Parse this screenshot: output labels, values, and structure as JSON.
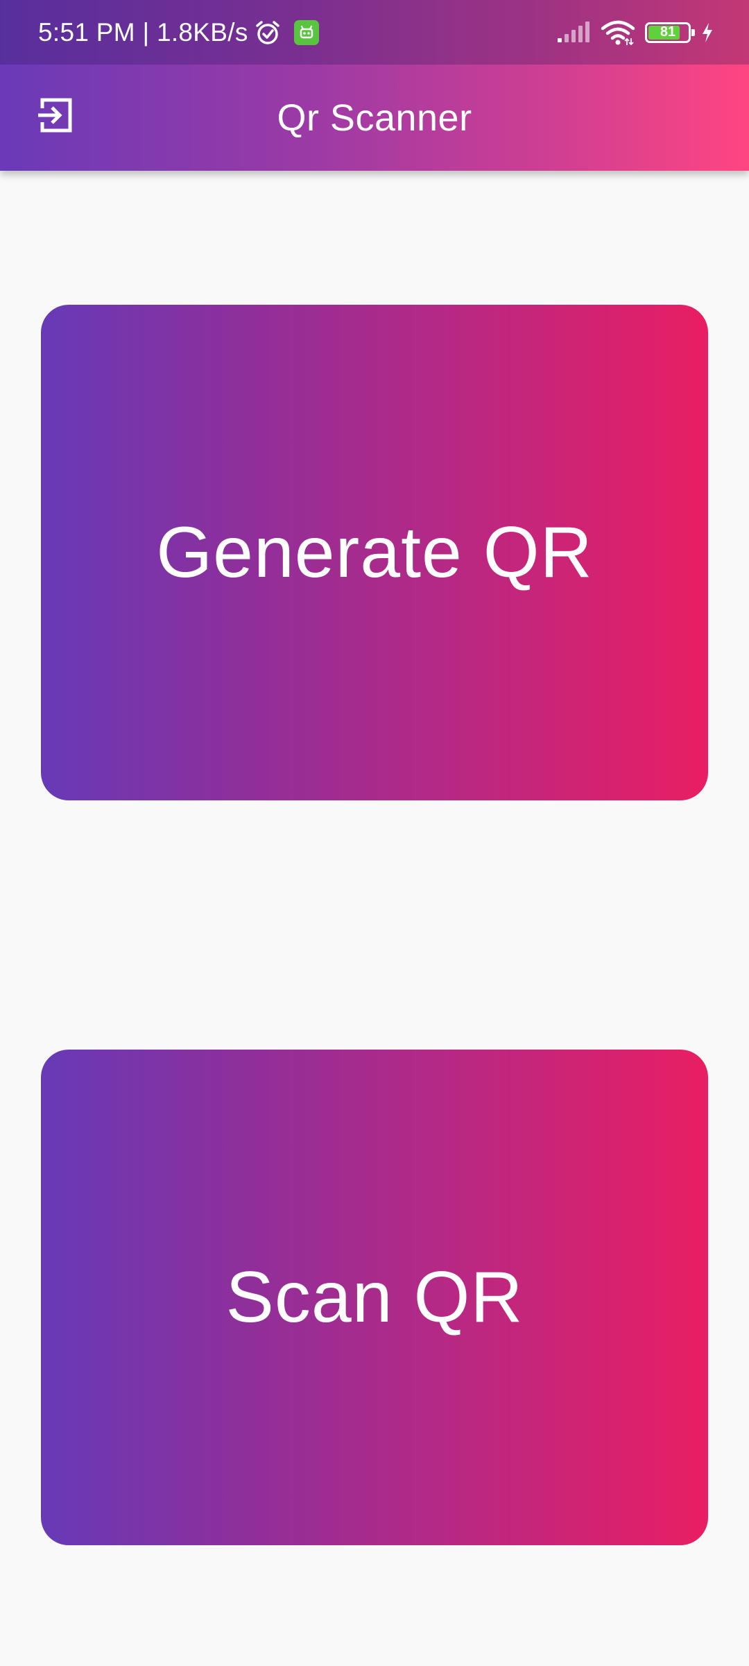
{
  "status_bar": {
    "time_text": "5:51 PM | 1.8KB/s",
    "battery_level": "81",
    "battery_fraction": 0.81,
    "icons": [
      "alarm-icon",
      "app-notification-icon",
      "signal-icon",
      "wifi-icon",
      "battery-icon",
      "charging-icon"
    ]
  },
  "app_bar": {
    "title": "Qr Scanner",
    "leading_icon": "exit-to-app-icon"
  },
  "main": {
    "generate_label": "Generate QR",
    "scan_label": "Scan QR"
  },
  "colors": {
    "gradient_start": "#673ab7",
    "gradient_end": "#e91e63",
    "appbar_end": "#ff4581",
    "background": "#f9f9f9",
    "text": "#ffffff"
  }
}
